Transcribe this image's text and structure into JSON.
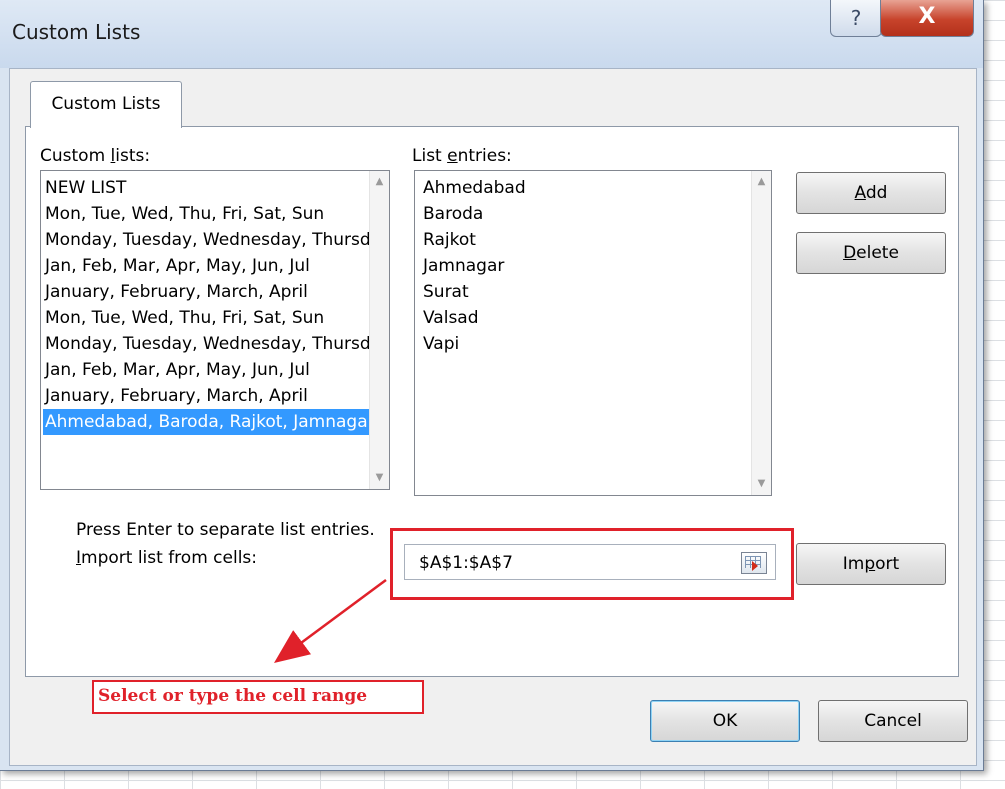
{
  "window": {
    "title": "Custom Lists",
    "help_glyph": "?",
    "close_glyph": "X"
  },
  "tab": {
    "label": "Custom Lists"
  },
  "custom_lists": {
    "label_pre": "Custom ",
    "label_key": "l",
    "label_post": "ists:",
    "items": [
      "NEW LIST",
      "Mon, Tue, Wed, Thu, Fri, Sat, Sun",
      "Monday, Tuesday, Wednesday, Thursday",
      "Jan, Feb, Mar, Apr, May, Jun, Jul",
      "January, February, March, April",
      "Mon, Tue, Wed, Thu, Fri, Sat, Sun",
      "Monday, Tuesday, Wednesday, Thursday",
      "Jan, Feb, Mar, Apr, May, Jun, Jul",
      "January, February, March, April",
      "Ahmedabad, Baroda, Rajkot, Jamnagar"
    ],
    "selected_index": 9
  },
  "list_entries": {
    "label_pre": "List ",
    "label_key": "e",
    "label_post": "ntries:",
    "items": [
      "Ahmedabad",
      "Baroda",
      "Rajkot",
      "Jamnagar",
      "Surat",
      "Valsad",
      "Vapi"
    ]
  },
  "buttons": {
    "add_key": "A",
    "add_rest": "dd",
    "delete_key": "D",
    "delete_rest": "elete",
    "import_pre": "Im",
    "import_key": "p",
    "import_post": "ort",
    "ok": "OK",
    "cancel": "Cancel"
  },
  "hint": "Press Enter to separate list entries.",
  "import": {
    "label_key": "I",
    "label_rest": "mport list from cells:",
    "value": "$A$1:$A$7"
  },
  "annotation": {
    "text": "Select or type the cell range",
    "color": "#e0212a"
  },
  "colors": {
    "selection": "#3399ff",
    "close_button": "#c7432b",
    "annotation": "#e0212a"
  }
}
